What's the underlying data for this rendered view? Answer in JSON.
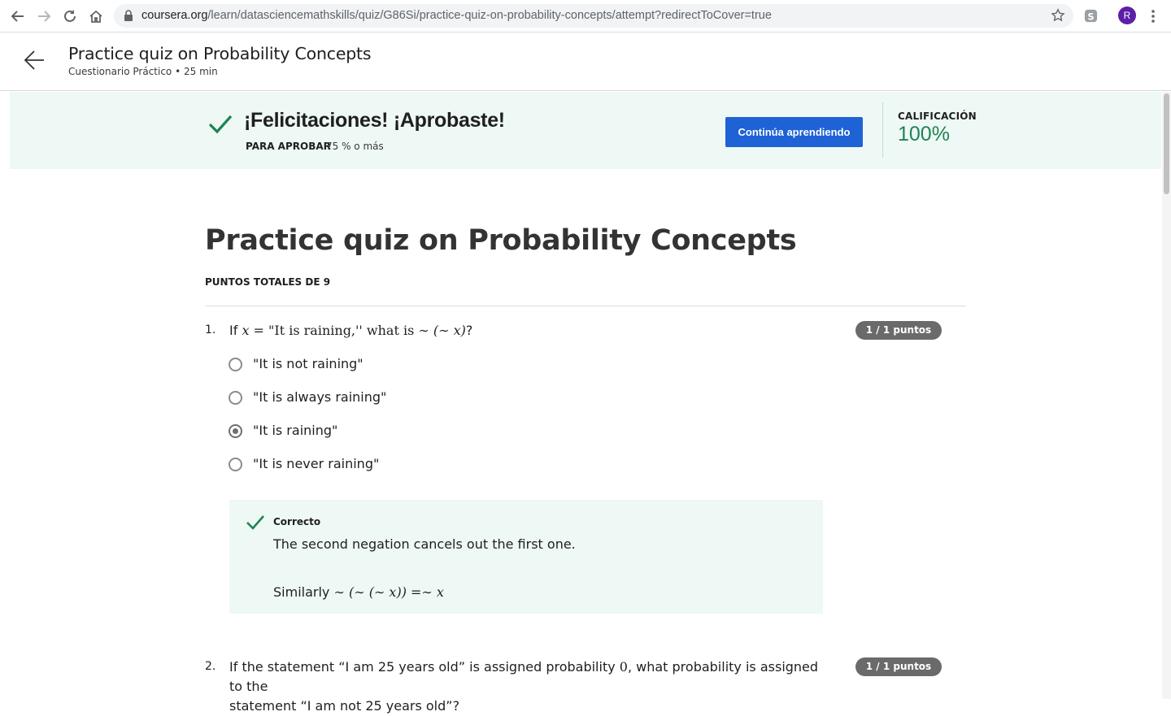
{
  "browser": {
    "url_domain": "coursera.org",
    "url_path": "/learn/datasciencemathskills/quiz/G86Si/practice-quiz-on-probability-concepts/attempt?redirectToCover=true",
    "profile_initial": "R"
  },
  "header": {
    "title": "Practice quiz on Probability Concepts",
    "subtitle": "Cuestionario Práctico • 25 min"
  },
  "banner": {
    "title": "¡Felicitaciones! ¡Aprobaste!",
    "pass_label": "PARA APROBAR",
    "pass_value": "75 % o más",
    "continue_label": "Continúa aprendiendo",
    "grade_label": "CALIFICACIÓN",
    "grade_value": "100%",
    "accent_color": "#1f8354",
    "button_color": "#1f62d6"
  },
  "quiz": {
    "title": "Practice quiz on Probability Concepts",
    "total_points_label": "PUNTOS TOTALES DE 9",
    "questions": [
      {
        "number": "1.",
        "text_prefix": "If ",
        "text_var": "x",
        "text_mid": " = \"It is raining,'' what is ",
        "text_expr": "∼ (∼ x)",
        "text_suffix": "?",
        "points": "1 / 1 puntos",
        "options": [
          {
            "label": "\"It is not raining\"",
            "selected": false
          },
          {
            "label": "\"It is always raining\"",
            "selected": false
          },
          {
            "label": "\"It is raining\"",
            "selected": true
          },
          {
            "label": "\"It is never raining\"",
            "selected": false
          }
        ],
        "feedback": {
          "status": "Correcto",
          "text1": "The second negation cancels out the first one.",
          "text2_prefix": "Similarly ",
          "text2_expr": "∼ (∼ (∼ x)) =∼ x"
        }
      },
      {
        "number": "2.",
        "text_line1_prefix": "If the statement “I am 25 years old” is assigned probability ",
        "text_line1_value": "0",
        "text_line1_suffix": ", what probability is assigned to the",
        "text_line2": "statement “I am not 25 years old”?",
        "points": "1 / 1 puntos"
      }
    ]
  }
}
